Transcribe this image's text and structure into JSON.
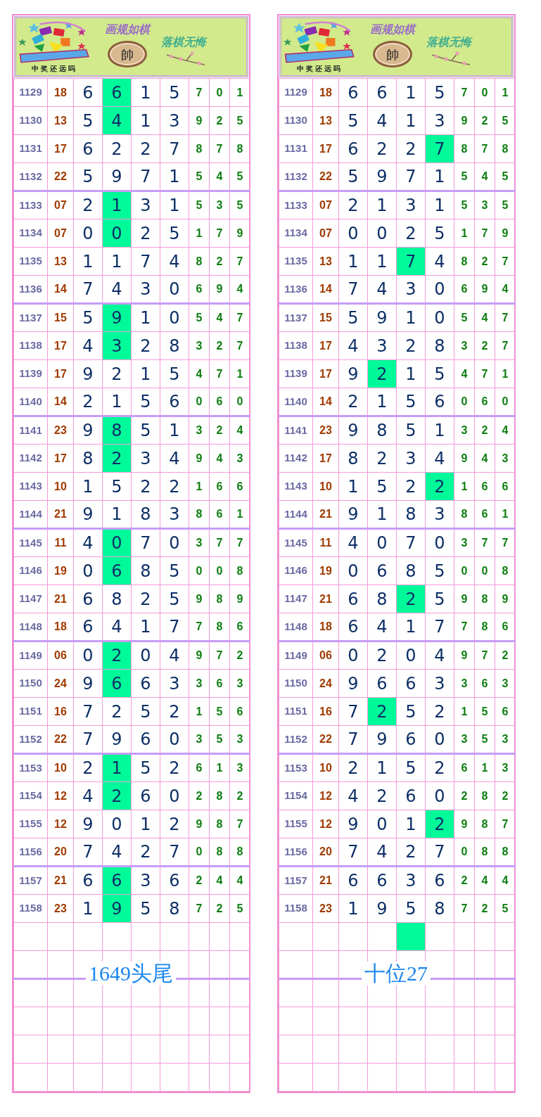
{
  "panels": [
    {
      "banner": {
        "slogan_top": "画规如棋",
        "seal": "帥",
        "slogan_right": "落棋无悔",
        "tagline": "中奖还远吗"
      },
      "rows": [
        {
          "issue": "1129",
          "sum": "18",
          "digits": [
            {
              "value": "6",
              "selected": false
            },
            {
              "value": "6",
              "selected": true
            },
            {
              "value": "1",
              "selected": false
            },
            {
              "value": "5",
              "selected": false
            }
          ],
          "tails": [
            "7",
            "0",
            "1"
          ]
        },
        {
          "issue": "1130",
          "sum": "13",
          "digits": [
            {
              "value": "5",
              "selected": false
            },
            {
              "value": "4",
              "selected": true
            },
            {
              "value": "1",
              "selected": false
            },
            {
              "value": "3",
              "selected": false
            }
          ],
          "tails": [
            "9",
            "2",
            "5"
          ]
        },
        {
          "issue": "1131",
          "sum": "17",
          "digits": [
            {
              "value": "6",
              "selected": false
            },
            {
              "value": "2",
              "selected": false
            },
            {
              "value": "2",
              "selected": false
            },
            {
              "value": "7",
              "selected": false
            }
          ],
          "tails": [
            "8",
            "7",
            "8"
          ]
        },
        {
          "issue": "1132",
          "sum": "22",
          "digits": [
            {
              "value": "5",
              "selected": false
            },
            {
              "value": "9",
              "selected": false
            },
            {
              "value": "7",
              "selected": false
            },
            {
              "value": "1",
              "selected": false
            }
          ],
          "tails": [
            "5",
            "4",
            "5"
          ]
        },
        {
          "issue": "1133",
          "sum": "07",
          "digits": [
            {
              "value": "2",
              "selected": false
            },
            {
              "value": "1",
              "selected": true
            },
            {
              "value": "3",
              "selected": false
            },
            {
              "value": "1",
              "selected": false
            }
          ],
          "tails": [
            "5",
            "3",
            "5"
          ]
        },
        {
          "issue": "1134",
          "sum": "07",
          "digits": [
            {
              "value": "0",
              "selected": false
            },
            {
              "value": "0",
              "selected": true
            },
            {
              "value": "2",
              "selected": false
            },
            {
              "value": "5",
              "selected": false
            }
          ],
          "tails": [
            "1",
            "7",
            "9"
          ]
        },
        {
          "issue": "1135",
          "sum": "13",
          "digits": [
            {
              "value": "1",
              "selected": false
            },
            {
              "value": "1",
              "selected": false
            },
            {
              "value": "7",
              "selected": false
            },
            {
              "value": "4",
              "selected": false
            }
          ],
          "tails": [
            "8",
            "2",
            "7"
          ]
        },
        {
          "issue": "1136",
          "sum": "14",
          "digits": [
            {
              "value": "7",
              "selected": false
            },
            {
              "value": "4",
              "selected": false
            },
            {
              "value": "3",
              "selected": false
            },
            {
              "value": "0",
              "selected": false
            }
          ],
          "tails": [
            "6",
            "9",
            "4"
          ]
        },
        {
          "issue": "1137",
          "sum": "15",
          "digits": [
            {
              "value": "5",
              "selected": false
            },
            {
              "value": "9",
              "selected": true
            },
            {
              "value": "1",
              "selected": false
            },
            {
              "value": "0",
              "selected": false
            }
          ],
          "tails": [
            "5",
            "4",
            "7"
          ]
        },
        {
          "issue": "1138",
          "sum": "17",
          "digits": [
            {
              "value": "4",
              "selected": false
            },
            {
              "value": "3",
              "selected": true
            },
            {
              "value": "2",
              "selected": false
            },
            {
              "value": "8",
              "selected": false
            }
          ],
          "tails": [
            "3",
            "2",
            "7"
          ]
        },
        {
          "issue": "1139",
          "sum": "17",
          "digits": [
            {
              "value": "9",
              "selected": false
            },
            {
              "value": "2",
              "selected": false
            },
            {
              "value": "1",
              "selected": false
            },
            {
              "value": "5",
              "selected": false
            }
          ],
          "tails": [
            "4",
            "7",
            "1"
          ]
        },
        {
          "issue": "1140",
          "sum": "14",
          "digits": [
            {
              "value": "2",
              "selected": false
            },
            {
              "value": "1",
              "selected": false
            },
            {
              "value": "5",
              "selected": false
            },
            {
              "value": "6",
              "selected": false
            }
          ],
          "tails": [
            "0",
            "6",
            "0"
          ]
        },
        {
          "issue": "1141",
          "sum": "23",
          "digits": [
            {
              "value": "9",
              "selected": false
            },
            {
              "value": "8",
              "selected": true
            },
            {
              "value": "5",
              "selected": false
            },
            {
              "value": "1",
              "selected": false
            }
          ],
          "tails": [
            "3",
            "2",
            "4"
          ]
        },
        {
          "issue": "1142",
          "sum": "17",
          "digits": [
            {
              "value": "8",
              "selected": false
            },
            {
              "value": "2",
              "selected": true
            },
            {
              "value": "3",
              "selected": false
            },
            {
              "value": "4",
              "selected": false
            }
          ],
          "tails": [
            "9",
            "4",
            "3"
          ]
        },
        {
          "issue": "1143",
          "sum": "10",
          "digits": [
            {
              "value": "1",
              "selected": false
            },
            {
              "value": "5",
              "selected": false
            },
            {
              "value": "2",
              "selected": false
            },
            {
              "value": "2",
              "selected": false
            }
          ],
          "tails": [
            "1",
            "6",
            "6"
          ]
        },
        {
          "issue": "1144",
          "sum": "21",
          "digits": [
            {
              "value": "9",
              "selected": false
            },
            {
              "value": "1",
              "selected": false
            },
            {
              "value": "8",
              "selected": false
            },
            {
              "value": "3",
              "selected": false
            }
          ],
          "tails": [
            "8",
            "6",
            "1"
          ]
        },
        {
          "issue": "1145",
          "sum": "11",
          "digits": [
            {
              "value": "4",
              "selected": false
            },
            {
              "value": "0",
              "selected": true
            },
            {
              "value": "7",
              "selected": false
            },
            {
              "value": "0",
              "selected": false
            }
          ],
          "tails": [
            "3",
            "7",
            "7"
          ]
        },
        {
          "issue": "1146",
          "sum": "19",
          "digits": [
            {
              "value": "0",
              "selected": false
            },
            {
              "value": "6",
              "selected": true
            },
            {
              "value": "8",
              "selected": false
            },
            {
              "value": "5",
              "selected": false
            }
          ],
          "tails": [
            "0",
            "0",
            "8"
          ]
        },
        {
          "issue": "1147",
          "sum": "21",
          "digits": [
            {
              "value": "6",
              "selected": false
            },
            {
              "value": "8",
              "selected": false
            },
            {
              "value": "2",
              "selected": false
            },
            {
              "value": "5",
              "selected": false
            }
          ],
          "tails": [
            "9",
            "8",
            "9"
          ]
        },
        {
          "issue": "1148",
          "sum": "18",
          "digits": [
            {
              "value": "6",
              "selected": false
            },
            {
              "value": "4",
              "selected": false
            },
            {
              "value": "1",
              "selected": false
            },
            {
              "value": "7",
              "selected": false
            }
          ],
          "tails": [
            "7",
            "8",
            "6"
          ]
        },
        {
          "issue": "1149",
          "sum": "06",
          "digits": [
            {
              "value": "0",
              "selected": false
            },
            {
              "value": "2",
              "selected": true
            },
            {
              "value": "0",
              "selected": false
            },
            {
              "value": "4",
              "selected": false
            }
          ],
          "tails": [
            "9",
            "7",
            "2"
          ]
        },
        {
          "issue": "1150",
          "sum": "24",
          "digits": [
            {
              "value": "9",
              "selected": false
            },
            {
              "value": "6",
              "selected": true
            },
            {
              "value": "6",
              "selected": false
            },
            {
              "value": "3",
              "selected": false
            }
          ],
          "tails": [
            "3",
            "6",
            "3"
          ]
        },
        {
          "issue": "1151",
          "sum": "16",
          "digits": [
            {
              "value": "7",
              "selected": false
            },
            {
              "value": "2",
              "selected": false
            },
            {
              "value": "5",
              "selected": false
            },
            {
              "value": "2",
              "selected": false
            }
          ],
          "tails": [
            "1",
            "5",
            "6"
          ]
        },
        {
          "issue": "1152",
          "sum": "22",
          "digits": [
            {
              "value": "7",
              "selected": false
            },
            {
              "value": "9",
              "selected": false
            },
            {
              "value": "6",
              "selected": false
            },
            {
              "value": "0",
              "selected": false
            }
          ],
          "tails": [
            "3",
            "5",
            "3"
          ]
        },
        {
          "issue": "1153",
          "sum": "10",
          "digits": [
            {
              "value": "2",
              "selected": false
            },
            {
              "value": "1",
              "selected": true
            },
            {
              "value": "5",
              "selected": false
            },
            {
              "value": "2",
              "selected": false
            }
          ],
          "tails": [
            "6",
            "1",
            "3"
          ]
        },
        {
          "issue": "1154",
          "sum": "12",
          "digits": [
            {
              "value": "4",
              "selected": false
            },
            {
              "value": "2",
              "selected": true
            },
            {
              "value": "6",
              "selected": false
            },
            {
              "value": "0",
              "selected": false
            }
          ],
          "tails": [
            "2",
            "8",
            "2"
          ]
        },
        {
          "issue": "1155",
          "sum": "12",
          "digits": [
            {
              "value": "9",
              "selected": false
            },
            {
              "value": "0",
              "selected": false
            },
            {
              "value": "1",
              "selected": false
            },
            {
              "value": "2",
              "selected": false
            }
          ],
          "tails": [
            "9",
            "8",
            "7"
          ]
        },
        {
          "issue": "1156",
          "sum": "20",
          "digits": [
            {
              "value": "7",
              "selected": false
            },
            {
              "value": "4",
              "selected": false
            },
            {
              "value": "2",
              "selected": false
            },
            {
              "value": "7",
              "selected": false
            }
          ],
          "tails": [
            "0",
            "8",
            "8"
          ]
        },
        {
          "issue": "1157",
          "sum": "21",
          "digits": [
            {
              "value": "6",
              "selected": false
            },
            {
              "value": "6",
              "selected": true
            },
            {
              "value": "3",
              "selected": false
            },
            {
              "value": "6",
              "selected": false
            }
          ],
          "tails": [
            "2",
            "4",
            "4"
          ]
        },
        {
          "issue": "1158",
          "sum": "23",
          "digits": [
            {
              "value": "1",
              "selected": false
            },
            {
              "value": "9",
              "selected": true
            },
            {
              "value": "5",
              "selected": false
            },
            {
              "value": "8",
              "selected": false
            }
          ],
          "tails": [
            "7",
            "2",
            "5"
          ]
        }
      ],
      "next_row": [
        {
          "selected": false
        },
        {
          "selected": false
        },
        {
          "selected": false
        },
        {
          "selected": false
        }
      ],
      "label": "1649头尾"
    },
    {
      "banner": {
        "slogan_top": "画规如棋",
        "seal": "帥",
        "slogan_right": "落棋无悔",
        "tagline": "中奖还远吗"
      },
      "rows": [
        {
          "issue": "1129",
          "sum": "18",
          "digits": [
            {
              "value": "6",
              "selected": false
            },
            {
              "value": "6",
              "selected": false
            },
            {
              "value": "1",
              "selected": false
            },
            {
              "value": "5",
              "selected": false
            }
          ],
          "tails": [
            "7",
            "0",
            "1"
          ]
        },
        {
          "issue": "1130",
          "sum": "13",
          "digits": [
            {
              "value": "5",
              "selected": false
            },
            {
              "value": "4",
              "selected": false
            },
            {
              "value": "1",
              "selected": false
            },
            {
              "value": "3",
              "selected": false
            }
          ],
          "tails": [
            "9",
            "2",
            "5"
          ]
        },
        {
          "issue": "1131",
          "sum": "17",
          "digits": [
            {
              "value": "6",
              "selected": false
            },
            {
              "value": "2",
              "selected": false
            },
            {
              "value": "2",
              "selected": false
            },
            {
              "value": "7",
              "selected": true
            }
          ],
          "tails": [
            "8",
            "7",
            "8"
          ]
        },
        {
          "issue": "1132",
          "sum": "22",
          "digits": [
            {
              "value": "5",
              "selected": false
            },
            {
              "value": "9",
              "selected": false
            },
            {
              "value": "7",
              "selected": false
            },
            {
              "value": "1",
              "selected": false
            }
          ],
          "tails": [
            "5",
            "4",
            "5"
          ]
        },
        {
          "issue": "1133",
          "sum": "07",
          "digits": [
            {
              "value": "2",
              "selected": false
            },
            {
              "value": "1",
              "selected": false
            },
            {
              "value": "3",
              "selected": false
            },
            {
              "value": "1",
              "selected": false
            }
          ],
          "tails": [
            "5",
            "3",
            "5"
          ]
        },
        {
          "issue": "1134",
          "sum": "07",
          "digits": [
            {
              "value": "0",
              "selected": false
            },
            {
              "value": "0",
              "selected": false
            },
            {
              "value": "2",
              "selected": false
            },
            {
              "value": "5",
              "selected": false
            }
          ],
          "tails": [
            "1",
            "7",
            "9"
          ]
        },
        {
          "issue": "1135",
          "sum": "13",
          "digits": [
            {
              "value": "1",
              "selected": false
            },
            {
              "value": "1",
              "selected": false
            },
            {
              "value": "7",
              "selected": true
            },
            {
              "value": "4",
              "selected": false
            }
          ],
          "tails": [
            "8",
            "2",
            "7"
          ]
        },
        {
          "issue": "1136",
          "sum": "14",
          "digits": [
            {
              "value": "7",
              "selected": false
            },
            {
              "value": "4",
              "selected": false
            },
            {
              "value": "3",
              "selected": false
            },
            {
              "value": "0",
              "selected": false
            }
          ],
          "tails": [
            "6",
            "9",
            "4"
          ]
        },
        {
          "issue": "1137",
          "sum": "15",
          "digits": [
            {
              "value": "5",
              "selected": false
            },
            {
              "value": "9",
              "selected": false
            },
            {
              "value": "1",
              "selected": false
            },
            {
              "value": "0",
              "selected": false
            }
          ],
          "tails": [
            "5",
            "4",
            "7"
          ]
        },
        {
          "issue": "1138",
          "sum": "17",
          "digits": [
            {
              "value": "4",
              "selected": false
            },
            {
              "value": "3",
              "selected": false
            },
            {
              "value": "2",
              "selected": false
            },
            {
              "value": "8",
              "selected": false
            }
          ],
          "tails": [
            "3",
            "2",
            "7"
          ]
        },
        {
          "issue": "1139",
          "sum": "17",
          "digits": [
            {
              "value": "9",
              "selected": false
            },
            {
              "value": "2",
              "selected": true
            },
            {
              "value": "1",
              "selected": false
            },
            {
              "value": "5",
              "selected": false
            }
          ],
          "tails": [
            "4",
            "7",
            "1"
          ]
        },
        {
          "issue": "1140",
          "sum": "14",
          "digits": [
            {
              "value": "2",
              "selected": false
            },
            {
              "value": "1",
              "selected": false
            },
            {
              "value": "5",
              "selected": false
            },
            {
              "value": "6",
              "selected": false
            }
          ],
          "tails": [
            "0",
            "6",
            "0"
          ]
        },
        {
          "issue": "1141",
          "sum": "23",
          "digits": [
            {
              "value": "9",
              "selected": false
            },
            {
              "value": "8",
              "selected": false
            },
            {
              "value": "5",
              "selected": false
            },
            {
              "value": "1",
              "selected": false
            }
          ],
          "tails": [
            "3",
            "2",
            "4"
          ]
        },
        {
          "issue": "1142",
          "sum": "17",
          "digits": [
            {
              "value": "8",
              "selected": false
            },
            {
              "value": "2",
              "selected": false
            },
            {
              "value": "3",
              "selected": false
            },
            {
              "value": "4",
              "selected": false
            }
          ],
          "tails": [
            "9",
            "4",
            "3"
          ]
        },
        {
          "issue": "1143",
          "sum": "10",
          "digits": [
            {
              "value": "1",
              "selected": false
            },
            {
              "value": "5",
              "selected": false
            },
            {
              "value": "2",
              "selected": false
            },
            {
              "value": "2",
              "selected": true
            }
          ],
          "tails": [
            "1",
            "6",
            "6"
          ]
        },
        {
          "issue": "1144",
          "sum": "21",
          "digits": [
            {
              "value": "9",
              "selected": false
            },
            {
              "value": "1",
              "selected": false
            },
            {
              "value": "8",
              "selected": false
            },
            {
              "value": "3",
              "selected": false
            }
          ],
          "tails": [
            "8",
            "6",
            "1"
          ]
        },
        {
          "issue": "1145",
          "sum": "11",
          "digits": [
            {
              "value": "4",
              "selected": false
            },
            {
              "value": "0",
              "selected": false
            },
            {
              "value": "7",
              "selected": false
            },
            {
              "value": "0",
              "selected": false
            }
          ],
          "tails": [
            "3",
            "7",
            "7"
          ]
        },
        {
          "issue": "1146",
          "sum": "19",
          "digits": [
            {
              "value": "0",
              "selected": false
            },
            {
              "value": "6",
              "selected": false
            },
            {
              "value": "8",
              "selected": false
            },
            {
              "value": "5",
              "selected": false
            }
          ],
          "tails": [
            "0",
            "0",
            "8"
          ]
        },
        {
          "issue": "1147",
          "sum": "21",
          "digits": [
            {
              "value": "6",
              "selected": false
            },
            {
              "value": "8",
              "selected": false
            },
            {
              "value": "2",
              "selected": true
            },
            {
              "value": "5",
              "selected": false
            }
          ],
          "tails": [
            "9",
            "8",
            "9"
          ]
        },
        {
          "issue": "1148",
          "sum": "18",
          "digits": [
            {
              "value": "6",
              "selected": false
            },
            {
              "value": "4",
              "selected": false
            },
            {
              "value": "1",
              "selected": false
            },
            {
              "value": "7",
              "selected": false
            }
          ],
          "tails": [
            "7",
            "8",
            "6"
          ]
        },
        {
          "issue": "1149",
          "sum": "06",
          "digits": [
            {
              "value": "0",
              "selected": false
            },
            {
              "value": "2",
              "selected": false
            },
            {
              "value": "0",
              "selected": false
            },
            {
              "value": "4",
              "selected": false
            }
          ],
          "tails": [
            "9",
            "7",
            "2"
          ]
        },
        {
          "issue": "1150",
          "sum": "24",
          "digits": [
            {
              "value": "9",
              "selected": false
            },
            {
              "value": "6",
              "selected": false
            },
            {
              "value": "6",
              "selected": false
            },
            {
              "value": "3",
              "selected": false
            }
          ],
          "tails": [
            "3",
            "6",
            "3"
          ]
        },
        {
          "issue": "1151",
          "sum": "16",
          "digits": [
            {
              "value": "7",
              "selected": false
            },
            {
              "value": "2",
              "selected": true
            },
            {
              "value": "5",
              "selected": false
            },
            {
              "value": "2",
              "selected": false
            }
          ],
          "tails": [
            "1",
            "5",
            "6"
          ]
        },
        {
          "issue": "1152",
          "sum": "22",
          "digits": [
            {
              "value": "7",
              "selected": false
            },
            {
              "value": "9",
              "selected": false
            },
            {
              "value": "6",
              "selected": false
            },
            {
              "value": "0",
              "selected": false
            }
          ],
          "tails": [
            "3",
            "5",
            "3"
          ]
        },
        {
          "issue": "1153",
          "sum": "10",
          "digits": [
            {
              "value": "2",
              "selected": false
            },
            {
              "value": "1",
              "selected": false
            },
            {
              "value": "5",
              "selected": false
            },
            {
              "value": "2",
              "selected": false
            }
          ],
          "tails": [
            "6",
            "1",
            "3"
          ]
        },
        {
          "issue": "1154",
          "sum": "12",
          "digits": [
            {
              "value": "4",
              "selected": false
            },
            {
              "value": "2",
              "selected": false
            },
            {
              "value": "6",
              "selected": false
            },
            {
              "value": "0",
              "selected": false
            }
          ],
          "tails": [
            "2",
            "8",
            "2"
          ]
        },
        {
          "issue": "1155",
          "sum": "12",
          "digits": [
            {
              "value": "9",
              "selected": false
            },
            {
              "value": "0",
              "selected": false
            },
            {
              "value": "1",
              "selected": false
            },
            {
              "value": "2",
              "selected": true
            }
          ],
          "tails": [
            "9",
            "8",
            "7"
          ]
        },
        {
          "issue": "1156",
          "sum": "20",
          "digits": [
            {
              "value": "7",
              "selected": false
            },
            {
              "value": "4",
              "selected": false
            },
            {
              "value": "2",
              "selected": false
            },
            {
              "value": "7",
              "selected": false
            }
          ],
          "tails": [
            "0",
            "8",
            "8"
          ]
        },
        {
          "issue": "1157",
          "sum": "21",
          "digits": [
            {
              "value": "6",
              "selected": false
            },
            {
              "value": "6",
              "selected": false
            },
            {
              "value": "3",
              "selected": false
            },
            {
              "value": "6",
              "selected": false
            }
          ],
          "tails": [
            "2",
            "4",
            "4"
          ]
        },
        {
          "issue": "1158",
          "sum": "23",
          "digits": [
            {
              "value": "1",
              "selected": false
            },
            {
              "value": "9",
              "selected": false
            },
            {
              "value": "5",
              "selected": false
            },
            {
              "value": "8",
              "selected": false
            }
          ],
          "tails": [
            "7",
            "2",
            "5"
          ]
        }
      ],
      "next_row": [
        {
          "selected": false
        },
        {
          "selected": false
        },
        {
          "selected": true
        },
        {
          "selected": false
        }
      ],
      "label": "十位27"
    }
  ]
}
